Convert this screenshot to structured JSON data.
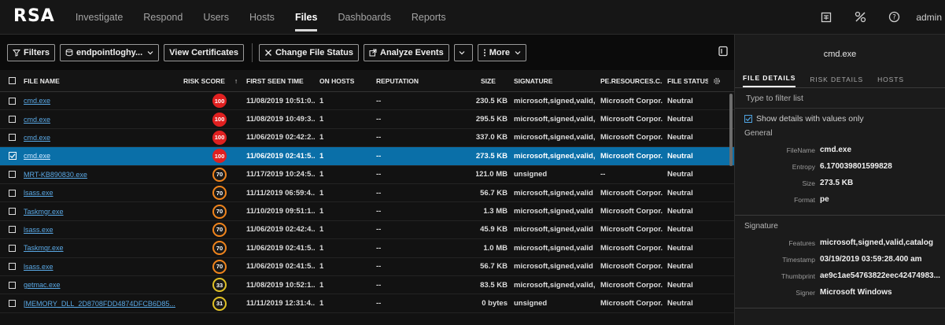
{
  "nav": {
    "logo": "RSA",
    "items": [
      "Investigate",
      "Respond",
      "Users",
      "Hosts",
      "Files",
      "Dashboards",
      "Reports"
    ],
    "active_index": 4,
    "user": "admin",
    "icons": [
      "report-icon",
      "tools-icon",
      "help-icon"
    ]
  },
  "toolbar": {
    "filters": "Filters",
    "source": "endpointloghy...",
    "view_certificates": "View Certificates",
    "change_file_status": "Change File Status",
    "analyze_events": "Analyze Events",
    "more": "More"
  },
  "table": {
    "columns": [
      "FILE NAME",
      "RISK SCORE",
      "FIRST SEEN TIME",
      "ON HOSTS",
      "REPUTATION",
      "SIZE",
      "SIGNATURE",
      "PE.RESOURCES.C...",
      "FILE STATUS"
    ],
    "sort_indicator": "↑",
    "rows": [
      {
        "name": "cmd.exe",
        "risk": "100",
        "level": "high",
        "first": "11/08/2019 10:51:0...",
        "hosts": "1",
        "rep": "--",
        "size": "230.5 KB",
        "sig": "microsoft,signed,valid,ca...",
        "pe": "Microsoft Corpor...",
        "status": "Neutral",
        "selected": false
      },
      {
        "name": "cmd.exe",
        "risk": "100",
        "level": "high",
        "first": "11/08/2019 10:49:3...",
        "hosts": "1",
        "rep": "--",
        "size": "295.5 KB",
        "sig": "microsoft,signed,valid,ca...",
        "pe": "Microsoft Corpor...",
        "status": "Neutral",
        "selected": false
      },
      {
        "name": "cmd.exe",
        "risk": "100",
        "level": "high",
        "first": "11/06/2019 02:42:2...",
        "hosts": "1",
        "rep": "--",
        "size": "337.0 KB",
        "sig": "microsoft,signed,valid,ca...",
        "pe": "Microsoft Corpor...",
        "status": "Neutral",
        "selected": false
      },
      {
        "name": "cmd.exe",
        "risk": "100",
        "level": "high",
        "first": "11/06/2019 02:41:5...",
        "hosts": "1",
        "rep": "--",
        "size": "273.5 KB",
        "sig": "microsoft,signed,valid,ca...",
        "pe": "Microsoft Corpor...",
        "status": "Neutral",
        "selected": true
      },
      {
        "name": "MRT-KB890830.exe",
        "risk": "70",
        "level": "med",
        "first": "11/17/2019 10:24:5...",
        "hosts": "1",
        "rep": "--",
        "size": "121.0 MB",
        "sig": "unsigned",
        "pe": "--",
        "status": "Neutral",
        "selected": false
      },
      {
        "name": "lsass.exe",
        "risk": "70",
        "level": "med",
        "first": "11/11/2019 06:59:4...",
        "hosts": "1",
        "rep": "--",
        "size": "56.7 KB",
        "sig": "microsoft,signed,valid",
        "pe": "Microsoft Corpor...",
        "status": "Neutral",
        "selected": false
      },
      {
        "name": "Taskmgr.exe",
        "risk": "70",
        "level": "med",
        "first": "11/10/2019 09:51:1...",
        "hosts": "1",
        "rep": "--",
        "size": "1.3 MB",
        "sig": "microsoft,signed,valid",
        "pe": "Microsoft Corpor...",
        "status": "Neutral",
        "selected": false
      },
      {
        "name": "lsass.exe",
        "risk": "70",
        "level": "med",
        "first": "11/06/2019 02:42:4...",
        "hosts": "1",
        "rep": "--",
        "size": "45.9 KB",
        "sig": "microsoft,signed,valid",
        "pe": "Microsoft Corpor...",
        "status": "Neutral",
        "selected": false
      },
      {
        "name": "Taskmgr.exe",
        "risk": "70",
        "level": "med",
        "first": "11/06/2019 02:41:5...",
        "hosts": "1",
        "rep": "--",
        "size": "1.0 MB",
        "sig": "microsoft,signed,valid",
        "pe": "Microsoft Corpor...",
        "status": "Neutral",
        "selected": false
      },
      {
        "name": "lsass.exe",
        "risk": "70",
        "level": "med",
        "first": "11/06/2019 02:41:5...",
        "hosts": "1",
        "rep": "--",
        "size": "56.7 KB",
        "sig": "microsoft,signed,valid",
        "pe": "Microsoft Corpor...",
        "status": "Neutral",
        "selected": false
      },
      {
        "name": "getmac.exe",
        "risk": "33",
        "level": "low",
        "first": "11/08/2019 10:52:1...",
        "hosts": "1",
        "rep": "--",
        "size": "83.5 KB",
        "sig": "microsoft,signed,valid,ca...",
        "pe": "Microsoft Corpor...",
        "status": "Neutral",
        "selected": false
      },
      {
        "name": "[MEMORY_DLL_2D8708FDD4874DFCB6D85...",
        "risk": "31",
        "level": "low",
        "first": "11/11/2019 12:31:4...",
        "hosts": "1",
        "rep": "--",
        "size": "0 bytes",
        "sig": "unsigned",
        "pe": "Microsoft Corpor...",
        "status": "Neutral",
        "selected": false
      }
    ]
  },
  "panel": {
    "title": "cmd.exe",
    "tabs": [
      "FILE DETAILS",
      "RISK DETAILS",
      "HOSTS"
    ],
    "filter_placeholder": "Type to filter list",
    "show_values": "Show details with values only",
    "general_label": "General",
    "general": [
      {
        "k": "FileName",
        "v": "cmd.exe"
      },
      {
        "k": "Entropy",
        "v": "6.170039801599828"
      },
      {
        "k": "Size",
        "v": "273.5 KB"
      },
      {
        "k": "Format",
        "v": "pe"
      }
    ],
    "signature_label": "Signature",
    "signature": [
      {
        "k": "Features",
        "v": "microsoft,signed,valid,catalog"
      },
      {
        "k": "Timestamp",
        "v": "03/19/2019 03:59:28.400 am"
      },
      {
        "k": "Thumbprint",
        "v": "ae9c1ae54763822eec42474983..."
      },
      {
        "k": "Signer",
        "v": "Microsoft Windows"
      }
    ]
  },
  "colors": {
    "selected_row": "#0a6fa8",
    "risk_high": "#e02020",
    "risk_med": "#f0841c",
    "risk_low": "#e0c025",
    "link": "#5aa9e6"
  }
}
